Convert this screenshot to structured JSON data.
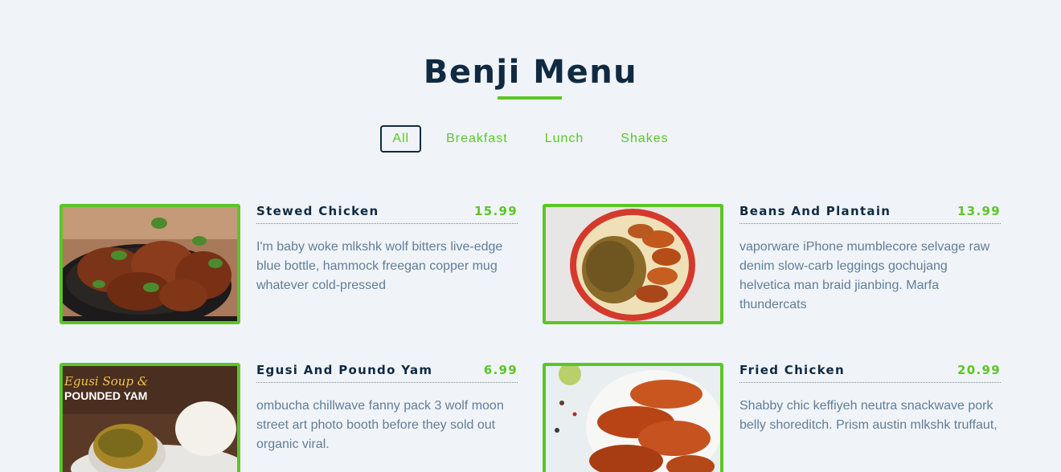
{
  "page": {
    "title": "Benji Menu"
  },
  "filters": [
    "All",
    "Breakfast",
    "Lunch",
    "Shakes"
  ],
  "colors": {
    "accent": "#5bc627",
    "heading": "#102a42",
    "text": "#617d98",
    "background": "#f0f4f8"
  },
  "items": [
    {
      "name": "Stewed Chicken",
      "price": "15.99",
      "desc": "I'm baby woke mlkshk wolf bitters live-edge blue bottle, hammock freegan copper mug whatever cold-pressed"
    },
    {
      "name": "Beans And Plantain",
      "price": "13.99",
      "desc": "vaporware iPhone mumblecore selvage raw denim slow-carb leggings gochujang helvetica man braid jianbing. Marfa thundercats"
    },
    {
      "name": "Egusi And Poundo Yam",
      "price": "6.99",
      "desc": "ombucha chillwave fanny pack 3 wolf moon street art photo booth before they sold out organic viral."
    },
    {
      "name": "Fried Chicken",
      "price": "20.99",
      "desc": "Shabby chic keffiyeh neutra snackwave pork belly shoreditch. Prism austin mlkshk truffaut,"
    }
  ],
  "photo_texts": {
    "egusi_line1": "Egusi Soup &",
    "egusi_line2": "POUNDED YAM"
  }
}
